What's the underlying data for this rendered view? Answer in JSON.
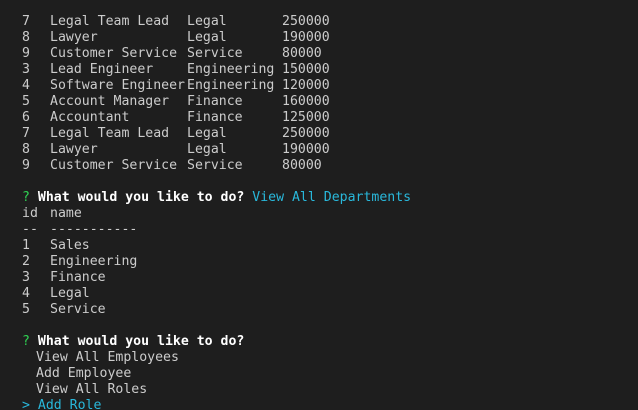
{
  "roles_rows": [
    {
      "id": "7",
      "title": "Legal Team Lead",
      "department": "Legal",
      "salary": "250000"
    },
    {
      "id": "8",
      "title": "Lawyer",
      "department": "Legal",
      "salary": "190000"
    },
    {
      "id": "9",
      "title": "Customer Service",
      "department": "Service",
      "salary": "80000"
    },
    {
      "id": "3",
      "title": "Lead Engineer",
      "department": "Engineering",
      "salary": "150000"
    },
    {
      "id": "4",
      "title": "Software Engineer",
      "department": "Engineering",
      "salary": "120000"
    },
    {
      "id": "5",
      "title": "Account Manager",
      "department": "Finance",
      "salary": "160000"
    },
    {
      "id": "6",
      "title": "Accountant",
      "department": "Finance",
      "salary": "125000"
    },
    {
      "id": "7",
      "title": "Legal Team Lead",
      "department": "Legal",
      "salary": "250000"
    },
    {
      "id": "8",
      "title": "Lawyer",
      "department": "Legal",
      "salary": "190000"
    },
    {
      "id": "9",
      "title": "Customer Service",
      "department": "Service",
      "salary": "80000"
    }
  ],
  "prompt1": {
    "mark": "?",
    "question": "What would you like to do?",
    "answer": "View All Departments"
  },
  "departments_table": {
    "header": {
      "id": "id",
      "name": "name"
    },
    "separator": {
      "id": "--",
      "name": "-----------"
    },
    "rows": [
      {
        "id": "1",
        "name": "Sales"
      },
      {
        "id": "2",
        "name": "Engineering"
      },
      {
        "id": "3",
        "name": "Finance"
      },
      {
        "id": "4",
        "name": "Legal"
      },
      {
        "id": "5",
        "name": "Service"
      }
    ]
  },
  "prompt2": {
    "mark": "?",
    "question": "What would you like to do?",
    "choices": [
      "View All Employees",
      "Add Employee",
      "View All Roles",
      "Add Role"
    ],
    "pointer": ">"
  },
  "colors": {
    "background": "#1e1e1e",
    "text": "#cccccc",
    "question_mark": "#2fd152",
    "accent": "#29b8db"
  }
}
